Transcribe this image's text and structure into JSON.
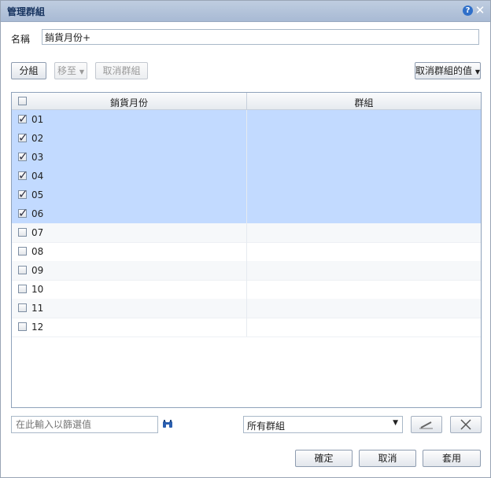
{
  "dialog": {
    "title": "管理群組",
    "help_symbol": "?",
    "close_symbol": "✕"
  },
  "name_field": {
    "label": "名稱",
    "value": "銷貨月份+"
  },
  "toolbar": {
    "group_label": "分組",
    "move_to_label": "移至",
    "ungroup_label": "取消群組",
    "ungroup_values_label": "取消群組的值"
  },
  "grid": {
    "columns": [
      "銷貨月份",
      "群組"
    ],
    "rows": [
      {
        "value": "01",
        "checked": true
      },
      {
        "value": "02",
        "checked": true
      },
      {
        "value": "03",
        "checked": true
      },
      {
        "value": "04",
        "checked": true
      },
      {
        "value": "05",
        "checked": true
      },
      {
        "value": "06",
        "checked": true
      },
      {
        "value": "07",
        "checked": false
      },
      {
        "value": "08",
        "checked": false
      },
      {
        "value": "09",
        "checked": false
      },
      {
        "value": "10",
        "checked": false
      },
      {
        "value": "11",
        "checked": false
      },
      {
        "value": "12",
        "checked": false
      }
    ]
  },
  "filter": {
    "placeholder": "在此輸入以篩選值"
  },
  "group_select": {
    "selected": "所有群組"
  },
  "footer": {
    "ok_label": "確定",
    "cancel_label": "取消",
    "apply_label": "套用"
  },
  "colors": {
    "selected_row": "#c2daff",
    "titlebar": "#b4c4dc"
  }
}
